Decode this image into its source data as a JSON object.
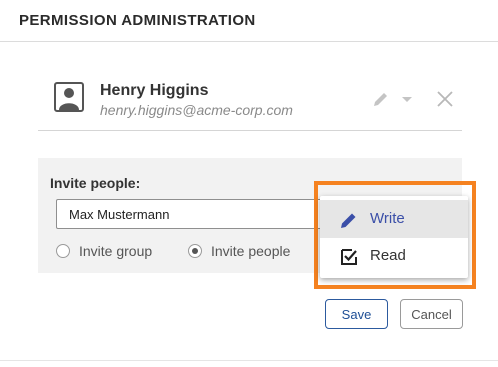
{
  "dialog": {
    "title": "PERMISSION ADMINISTRATION"
  },
  "user": {
    "name": "Henry Higgins",
    "email": "henry.higgins@acme-corp.com",
    "avatar_icon": "person-icon",
    "permission_icon": "pencil-icon",
    "dropdown_icon": "caret-down-icon",
    "remove_icon": "close-icon"
  },
  "invite": {
    "label": "Invite people:",
    "input_value": "Max Mustermann",
    "options": [
      {
        "label": "Invite group",
        "selected": false
      },
      {
        "label": "Invite people",
        "selected": true
      }
    ]
  },
  "permission_menu": {
    "items": [
      {
        "label": "Write",
        "icon": "pencil-icon",
        "active": true,
        "color": "#3b4fa8"
      },
      {
        "label": "Read",
        "icon": "checked-box-icon",
        "active": false,
        "color": "#333333"
      }
    ]
  },
  "buttons": {
    "save": "Save",
    "cancel": "Cancel"
  },
  "colors": {
    "highlight": "#f58220",
    "accent": "#1f4f96",
    "panel": "#f2f2f2"
  }
}
